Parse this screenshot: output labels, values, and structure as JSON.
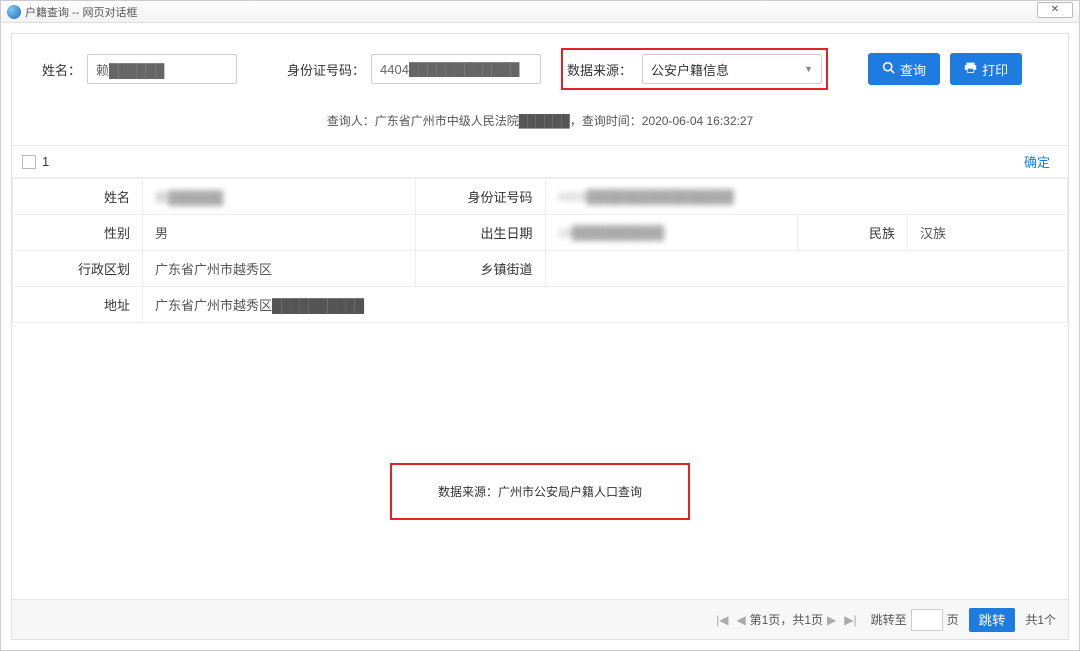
{
  "window": {
    "title": "户籍查询 -- 网页对话框",
    "close": "✕"
  },
  "search": {
    "name_label": "姓名：",
    "name_value": "赖██████",
    "id_label": "身份证号码：",
    "id_value": "4404████████████",
    "source_label": "数据来源：",
    "source_value": "公安户籍信息",
    "query_btn": "查询",
    "print_btn": "打印"
  },
  "meta_line": "查询人：广东省广州市中级人民法院██████，查询时间：2020-06-04 16:32:27",
  "record": {
    "index": "1",
    "confirm": "确定",
    "fields": {
      "name_k": "姓名",
      "name_v": "赖██████",
      "id_k": "身份证号码",
      "id_v": "4404████████████████",
      "gender_k": "性别",
      "gender_v": "男",
      "birth_k": "出生日期",
      "birth_v": "19██████████",
      "ethnic_k": "民族",
      "ethnic_v": "汉族",
      "region_k": "行政区划",
      "region_v": "广东省广州市越秀区",
      "town_k": "乡镇街道",
      "town_v": "",
      "addr_k": "地址",
      "addr_v": "广东省广州市越秀区██████████"
    }
  },
  "source_note": "数据来源：广州市公安局户籍人口查询",
  "pager": {
    "info": "第1页，共1页",
    "jump_label_pre": "跳转至",
    "jump_label_post": "页",
    "jump_btn": "跳转",
    "total": "共1个"
  }
}
